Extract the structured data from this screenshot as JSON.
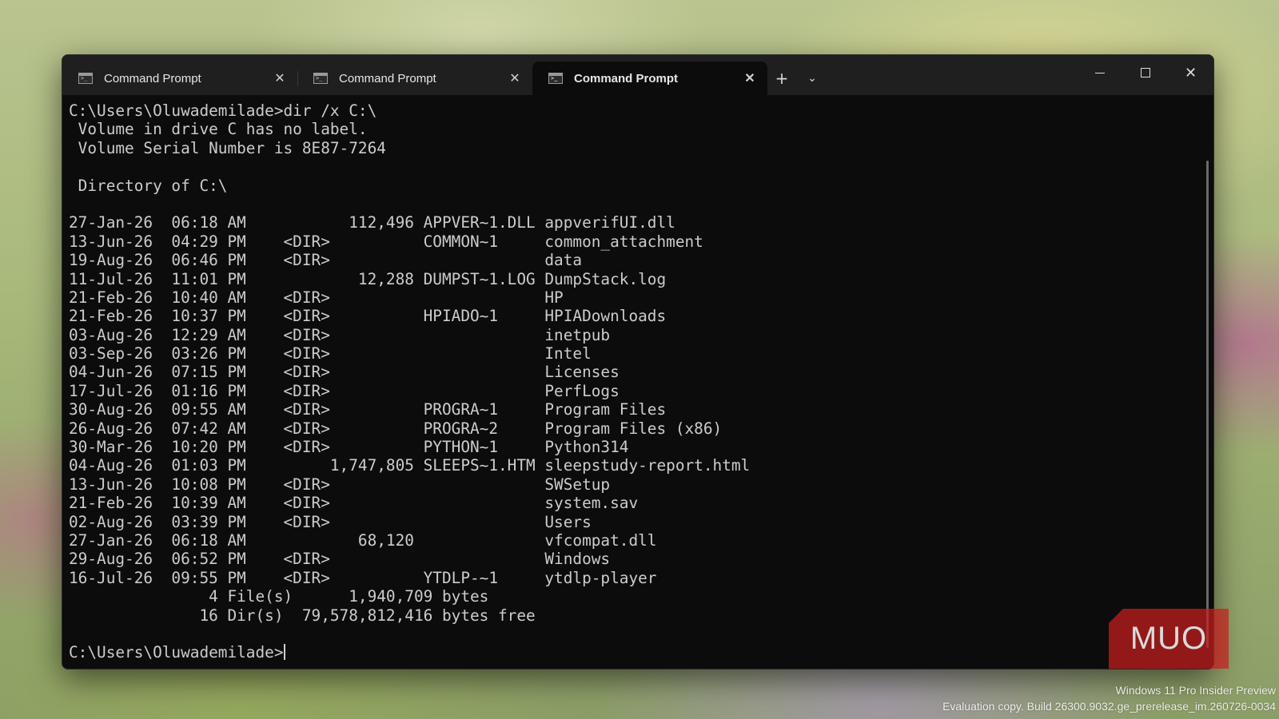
{
  "tabs": [
    {
      "label": "Command Prompt",
      "active": false
    },
    {
      "label": "Command Prompt",
      "active": false
    },
    {
      "label": "Command Prompt",
      "active": true
    }
  ],
  "titlebar": {
    "new_tab_glyph": "+",
    "dropdown_glyph": "⌄",
    "close_glyph": "✕"
  },
  "terminal": {
    "lines": [
      "C:\\Users\\Oluwademilade>dir /x C:\\",
      " Volume in drive C has no label.",
      " Volume Serial Number is 8E87-7264",
      "",
      " Directory of C:\\",
      "",
      "27-Jan-26  06:18 AM           112,496 APPVER~1.DLL appverifUI.dll",
      "13-Jun-26  04:29 PM    <DIR>          COMMON~1     common_attachment",
      "19-Aug-26  06:46 PM    <DIR>                       data",
      "11-Jul-26  11:01 PM            12,288 DUMPST~1.LOG DumpStack.log",
      "21-Feb-26  10:40 AM    <DIR>                       HP",
      "21-Feb-26  10:37 PM    <DIR>          HPIADO~1     HPIADownloads",
      "03-Aug-26  12:29 AM    <DIR>                       inetpub",
      "03-Sep-26  03:26 PM    <DIR>                       Intel",
      "04-Jun-26  07:15 PM    <DIR>                       Licenses",
      "17-Jul-26  01:16 PM    <DIR>                       PerfLogs",
      "30-Aug-26  09:55 AM    <DIR>          PROGRA~1     Program Files",
      "26-Aug-26  07:42 AM    <DIR>          PROGRA~2     Program Files (x86)",
      "30-Mar-26  10:20 PM    <DIR>          PYTHON~1     Python314",
      "04-Aug-26  01:03 PM         1,747,805 SLEEPS~1.HTM sleepstudy-report.html",
      "13-Jun-26  10:08 PM    <DIR>                       SWSetup",
      "21-Feb-26  10:39 AM    <DIR>                       system.sav",
      "02-Aug-26  03:39 PM    <DIR>                       Users",
      "27-Jan-26  06:18 AM            68,120              vfcompat.dll",
      "29-Aug-26  06:52 PM    <DIR>                       Windows",
      "16-Jul-26  09:55 PM    <DIR>          YTDLP-~1     ytdlp-player",
      "               4 File(s)      1,940,709 bytes",
      "              16 Dir(s)  79,578,812,416 bytes free",
      ""
    ],
    "prompt": "C:\\Users\\Oluwademilade>"
  },
  "watermark": {
    "logo_text": "MUO",
    "line1": "Windows 11 Pro Insider Preview",
    "line2": "Evaluation copy. Build 26300.9032.ge_prerelease_im.260726-0034"
  }
}
